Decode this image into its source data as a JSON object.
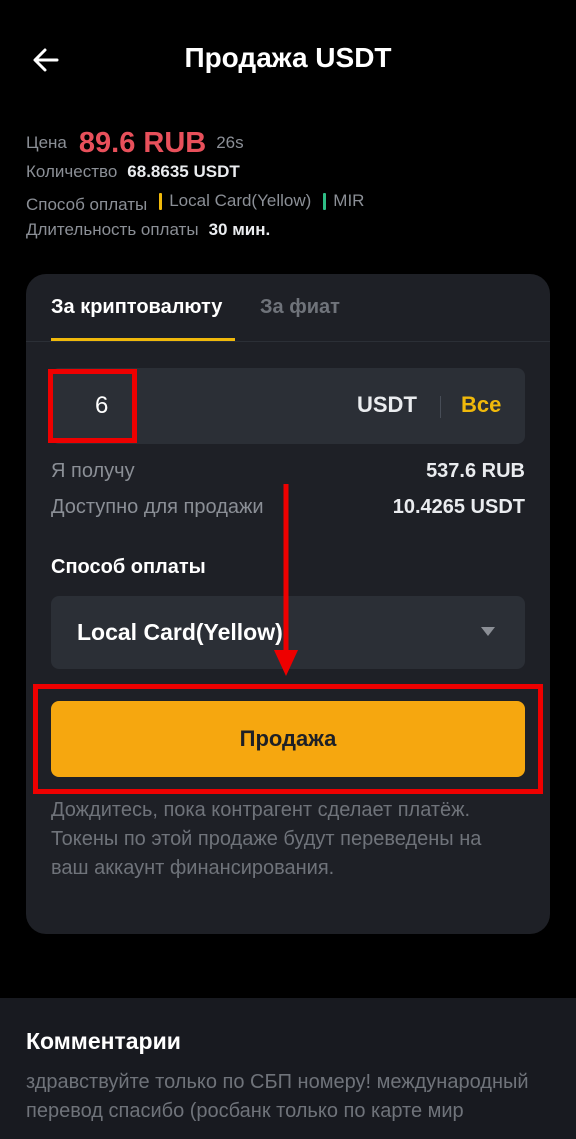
{
  "header": {
    "title": "Продажа USDT",
    "back_icon": "arrow-left-icon"
  },
  "order": {
    "price_label": "Цена",
    "price_value": "89.6 RUB",
    "price_timer": "26s",
    "quantity_label": "Количество",
    "quantity_value": "68.8635 USDT",
    "payment_label": "Способ оплаты",
    "payment_methods": [
      {
        "name": "Local Card(Yellow)",
        "color": "#f0b90b"
      },
      {
        "name": "MIR",
        "color": "#2ebd85"
      }
    ],
    "duration_label": "Длительность оплаты",
    "duration_value": "30 мин."
  },
  "tabs": [
    {
      "label": "За криптовалюту",
      "active": true
    },
    {
      "label": "За фиат",
      "active": false
    }
  ],
  "amount": {
    "value": "6",
    "unit": "USDT",
    "all_label": "Все"
  },
  "receive": {
    "label": "Я получу",
    "value": "537.6 RUB"
  },
  "available": {
    "label": "Доступно для продажи",
    "value": "10.4265 USDT"
  },
  "payment_select": {
    "label": "Способ оплаты",
    "value": "Local Card(Yellow)"
  },
  "sell_button": {
    "label": "Продажа"
  },
  "note": "Дождитесь, пока контрагент сделает платёж. Токены по этой продаже будут переведены на ваш аккаунт финансирования.",
  "comments": {
    "title": "Комментарии",
    "text": "здравствуйте только по СБП номеру! международный перевод спасибо (росбанк только по карте мир"
  },
  "colors": {
    "accent": "#f0b90b",
    "sell_button": "#f6a70f",
    "price": "#e8505b",
    "annotation": "#ee0000"
  }
}
